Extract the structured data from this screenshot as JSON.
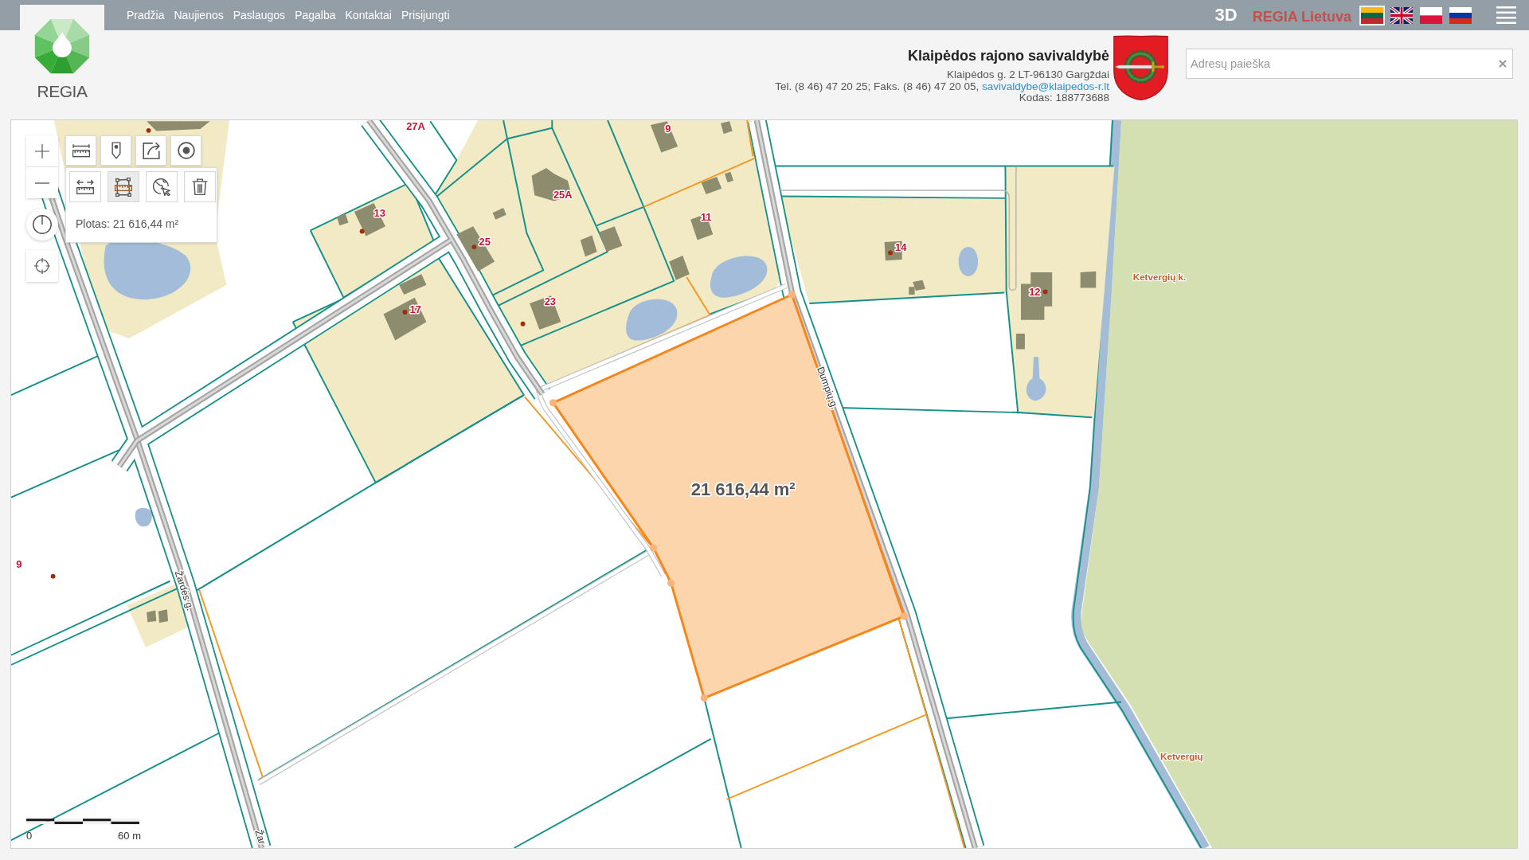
{
  "top_bar": {
    "nav": [
      "Pradžia",
      "Naujienos",
      "Paslaugos",
      "Pagalba",
      "Kontaktai",
      "Prisijungti"
    ],
    "view_3d": "3D",
    "portal_link": "REGIA Lietuva",
    "languages": [
      {
        "selected": true
      },
      {
        "selected": false
      },
      {
        "selected": false
      },
      {
        "selected": false
      }
    ]
  },
  "logo": {
    "text": "REGIA"
  },
  "municipality": {
    "name": "Klaipėdos rajono savivaldybė",
    "address": "Klaipėdos g. 2 LT-96130 Gargždai",
    "contacts": "Tel. (8 46) 47 20 25; Faks. (8 46) 47 20 05,",
    "email": "savivaldybe@klaipedos-r.lt",
    "code": "Kodas: 188773688"
  },
  "search": {
    "placeholder": "Adresų paieška"
  },
  "map": {
    "measure_tools": [
      {
        "selected": false
      },
      {
        "selected": true
      },
      {
        "selected": false
      },
      {
        "selected": false
      }
    ],
    "measurement": "Plotas: 21 616,44 m²",
    "area_label": "21 616,44 m²",
    "house_numbers": [
      "27A",
      "9",
      "25A",
      "13",
      "25",
      "11",
      "14",
      "17",
      "23",
      "12",
      "9"
    ],
    "street_names": [
      "Dumpių g.",
      "Žardės g.",
      "Žar"
    ],
    "place_names": [
      "Ketvergių k.",
      "Ketvergių"
    ],
    "scale": {
      "start": "0",
      "end": "60 m"
    }
  }
}
